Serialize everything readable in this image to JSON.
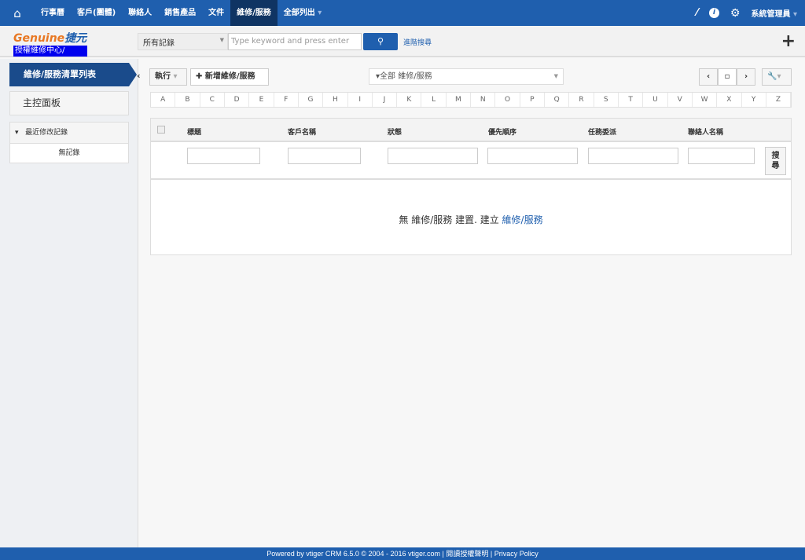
{
  "topnav": {
    "items": [
      "行事曆",
      "客戶(團體)",
      "聯絡人",
      "銷售產品",
      "文件",
      "維修/服務",
      "全部列出"
    ],
    "active": "維修/服務",
    "user": "系統管理員"
  },
  "header": {
    "logo_brand": "Genuine",
    "logo_cn": "捷元",
    "logo_sub": "授權維修中心/",
    "scope": "所有記錄",
    "search_placeholder": "Type keyword and press enter",
    "advanced": "進階搜尋"
  },
  "sidebar": {
    "active": "維修/服務清單列表",
    "dashboard": "主控面板",
    "recent_title": "最近修改記錄",
    "recent_empty": "無記錄"
  },
  "toolbar": {
    "actions": "執行",
    "add": "新增維修/服務",
    "filter": "全部 維修/服務"
  },
  "alphabet": [
    "A",
    "B",
    "C",
    "D",
    "E",
    "F",
    "G",
    "H",
    "I",
    "J",
    "K",
    "L",
    "M",
    "N",
    "O",
    "P",
    "Q",
    "R",
    "S",
    "T",
    "U",
    "V",
    "W",
    "X",
    "Y",
    "Z"
  ],
  "table": {
    "columns": [
      "標題",
      "客戶名稱",
      "狀態",
      "優先順序",
      "任務委派",
      "聯絡人名稱"
    ],
    "search_button": "搜尋",
    "empty_text": "無 維修/服務 建置. 建立",
    "empty_link": "維修/服務"
  },
  "footer": "Powered by vtiger CRM 6.5.0 © 2004 - 2016  vtiger.com | 閱讀授權聲明 | Privacy Policy",
  "colors": {
    "nav": "#1f5fae",
    "active": "#0f3463"
  }
}
